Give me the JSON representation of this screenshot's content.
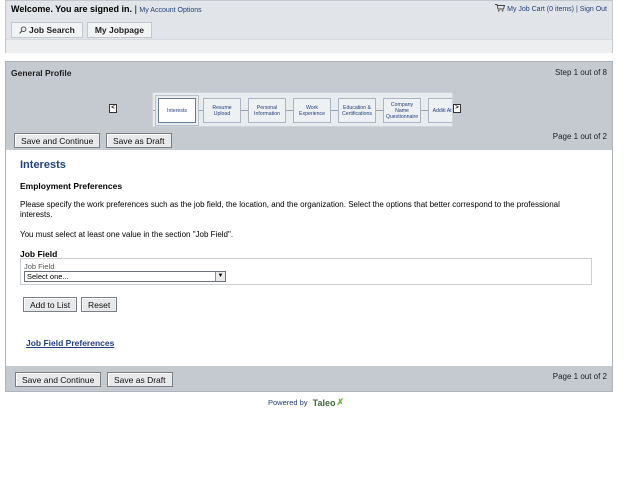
{
  "header": {
    "welcome": "Welcome. You are signed in.",
    "separator": "|",
    "account_options": "My Account Options",
    "job_cart": "My Job Cart (0 items)",
    "sign_out": "Sign Out",
    "tabs": [
      {
        "label": "Job Search",
        "icon": "search-icon"
      },
      {
        "label": "My Jobpage"
      }
    ]
  },
  "profile": {
    "title": "General Profile",
    "step_info": "Step 1 out of 8",
    "steps": [
      {
        "label": "Interests",
        "current": true
      },
      {
        "label": "Resume Upload"
      },
      {
        "label": "Personal Information"
      },
      {
        "label": "Work Experience"
      },
      {
        "label": "Education & Certifications"
      },
      {
        "label": "Company Name Questionnaire"
      },
      {
        "label": "Additi Attach"
      }
    ],
    "prev_arrow": "<",
    "next_arrow": ">",
    "save_continue": "Save and Continue",
    "save_draft": "Save as Draft",
    "page_info": "Page 1 out of 2"
  },
  "content": {
    "section_title": "Interests",
    "subheading": "Employment Preferences",
    "instructions": "Please specify the work preferences such as the job field, the location, and the organization. Select the options that better correspond to the professional interests.",
    "requirement": "You must select at least one value in the section \"Job Field\".",
    "field_heading": "Job Field",
    "field_label": "Job Field",
    "select_value": "Select one...",
    "add_to_list": "Add to List",
    "reset": "Reset",
    "preferences_link": "Job Field Preferences"
  },
  "footer": {
    "save_continue": "Save and Continue",
    "save_draft": "Save as Draft",
    "page_info": "Page 1 out of 2"
  },
  "branding": {
    "powered_by": "Powered by",
    "logo_text": "Taleo",
    "logo_mark": "✗",
    "accent_green": "#6fb33f",
    "link_blue": "#24407a"
  }
}
